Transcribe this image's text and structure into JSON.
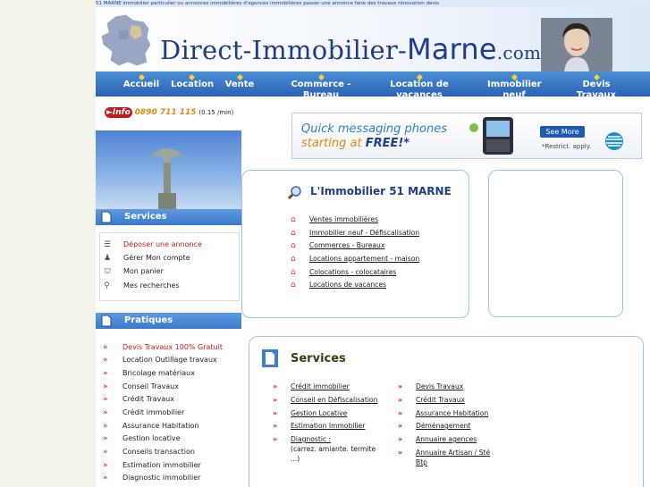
{
  "top_line": "51 MARNE immobilier particulier ou annonces immobilières d'agences immobilières passer une annonce faire des travaux rénovation devis",
  "banner": {
    "title_main": "Direct-Immobilier-",
    "title_marne": "Marne",
    "title_com": ".com"
  },
  "nav": [
    {
      "label": "Accueil",
      "sub": ""
    },
    {
      "label": "Location",
      "sub": ""
    },
    {
      "label": "Vente",
      "sub": ""
    },
    {
      "label": "Commerce -",
      "sub": "Bureau"
    },
    {
      "label": "Location de",
      "sub": "vacances"
    },
    {
      "label": "Immobilier",
      "sub": "neuf"
    },
    {
      "label": "Devis",
      "sub": "Travaux"
    }
  ],
  "info": {
    "tag": "Info",
    "number": "0890 711 115",
    "rate": "(0.15 /min)"
  },
  "ad": {
    "line1": "Quick messaging phones",
    "line2_prefix": "starting at ",
    "line2_bold": "FREE!*",
    "button": "See More",
    "restrict": "*Restrict. apply."
  },
  "sidebar": {
    "services_title": "Services",
    "services_items": [
      "Déposer une annonce",
      "Gérer Mon compte",
      "Mon panier",
      "Mes recherches"
    ],
    "pratiques_title": "Pratiques",
    "pratiques_items": [
      "Devis Travaux 100% Gratuit",
      "Location Outillage travaux",
      "Bricolage matériaux",
      "Conseil Travaux",
      "Crédit Travaux",
      "Crédit immobilier",
      "Assurance Habitation",
      "Gestion locative",
      "Conseils transaction",
      "Estimation immobilier",
      "Diagnostic immobilier"
    ]
  },
  "main": {
    "immo_title": "L'Immobilier 51 MARNE",
    "immo_links": [
      "Ventes immobilières",
      "Immobilier neuf - Défiscalisation",
      "Commerces - Bureaux",
      "Locations appartement - maison",
      "Colocations - colocataires",
      "Locations de vacances"
    ],
    "services_title": "Services",
    "services_col1": [
      "Crédit immobilier",
      "Conseil en Défiscalisation",
      "Gestion Locative",
      "Estimation Immobilier",
      "Diagnostic :"
    ],
    "diagnostic_detail_1": "(carrez. amiante. termite",
    "diagnostic_detail_2": "...)",
    "services_col2": [
      "Devis Travaux",
      "Crédit Travaux",
      "Assurance Habitation",
      "Déménagement",
      "Annuaire agences",
      "Annuaire Artisan / Sté",
      "Btp"
    ]
  },
  "colors": {
    "accent": "#2b62b4",
    "link_red": "#c41a1a",
    "title_blue": "#243a86"
  }
}
